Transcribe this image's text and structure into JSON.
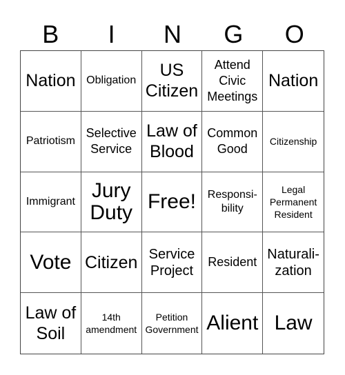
{
  "header": {
    "letters": [
      "B",
      "I",
      "N",
      "G",
      "O"
    ]
  },
  "cells": [
    {
      "text": "Nation",
      "size": "s-l"
    },
    {
      "text": "Obligation",
      "size": "s-s"
    },
    {
      "text": "US\nCitizen",
      "size": "s-l"
    },
    {
      "text": "Attend\nCivic\nMeetings",
      "size": "s-ms"
    },
    {
      "text": "Nation",
      "size": "s-l"
    },
    {
      "text": "Patriotism",
      "size": "s-s"
    },
    {
      "text": "Selective\nService",
      "size": "s-ms"
    },
    {
      "text": "Law of\nBlood",
      "size": "s-l"
    },
    {
      "text": "Common\nGood",
      "size": "s-ms"
    },
    {
      "text": "Citizenship",
      "size": "s-xs"
    },
    {
      "text": "Immigrant",
      "size": "s-s"
    },
    {
      "text": "Jury\nDuty",
      "size": "s-xl"
    },
    {
      "text": "Free!",
      "size": "s-xl"
    },
    {
      "text": "Responsi-\nbility",
      "size": "s-s"
    },
    {
      "text": "Legal\nPermanent\nResident",
      "size": "s-xs"
    },
    {
      "text": "Vote",
      "size": "s-xl"
    },
    {
      "text": "Citizen",
      "size": "s-l"
    },
    {
      "text": "Service\nProject",
      "size": "s-m"
    },
    {
      "text": "Resident",
      "size": "s-ms"
    },
    {
      "text": "Naturali-\nzation",
      "size": "s-m"
    },
    {
      "text": "Law of\nSoil",
      "size": "s-l"
    },
    {
      "text": "14th\namendment",
      "size": "s-xs"
    },
    {
      "text": "Petition\nGovernment",
      "size": "s-xs"
    },
    {
      "text": "Alient",
      "size": "s-xl"
    },
    {
      "text": "Law",
      "size": "s-xl"
    }
  ]
}
